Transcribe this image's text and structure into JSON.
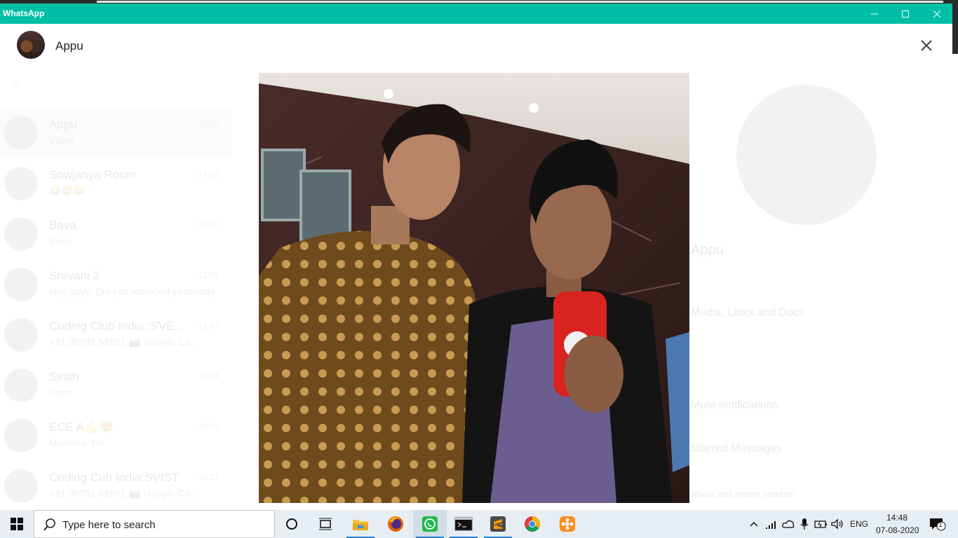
{
  "window": {
    "title": "WhatsApp"
  },
  "viewer": {
    "contact_name": "Appu"
  },
  "background": {
    "chats": [
      {
        "name": "Appu",
        "preview": "Video",
        "time": "15:30"
      },
      {
        "name": "Sowjanya Room",
        "preview": "😂😂😂",
        "time": "14:05"
      },
      {
        "name": "Bava",
        "preview": "Bava",
        "time": "13:40"
      },
      {
        "name": "Sravani 2",
        "preview": "Hey guys, Did you attended yesterday",
        "time": "12:58"
      },
      {
        "name": "Coding Club India :SVE...",
        "preview": "+91 95781 51691 📷 Google Co...",
        "time": "12:33"
      },
      {
        "name": "Sirish",
        "preview": "Hmm",
        "time": "11:14"
      },
      {
        "name": "ECE A💪😍",
        "preview": "Manisha: Ha",
        "time": "10:52"
      },
      {
        "name": "Coding Cub India:SVIST",
        "preview": "+91 95781 51691 📷 Google Co...",
        "time": "10:21"
      }
    ],
    "info": {
      "name": "Appu",
      "media_label": "Media, Links and Docs",
      "mute_label": "Mute notifications",
      "starred_label": "Starred Messages",
      "about_label": "About and phone number"
    }
  },
  "taskbar": {
    "search_placeholder": "Type here to search",
    "language": "ENG",
    "time": "14:48",
    "date": "07-08-2020",
    "notification_count": "1"
  },
  "colors": {
    "brand": "#00bfa5"
  }
}
